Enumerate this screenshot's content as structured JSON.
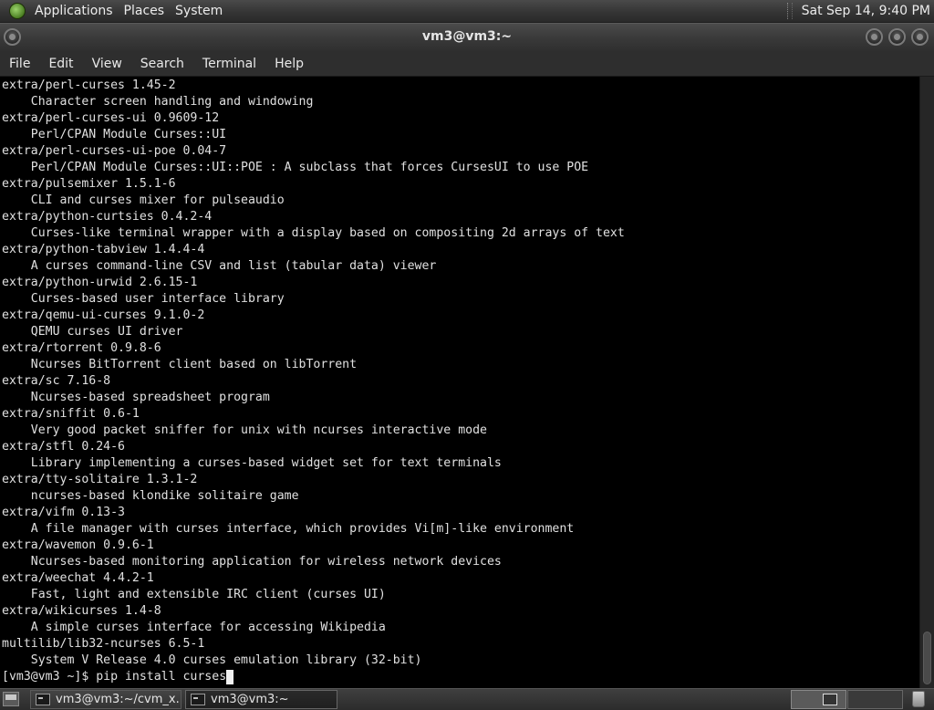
{
  "top_panel": {
    "menus": [
      "Applications",
      "Places",
      "System"
    ],
    "clock": "Sat Sep 14,  9:40 PM"
  },
  "window": {
    "title": "vm3@vm3:~"
  },
  "menubar": {
    "items": [
      "File",
      "Edit",
      "View",
      "Search",
      "Terminal",
      "Help"
    ]
  },
  "terminal": {
    "lines": [
      "extra/perl-curses 1.45-2",
      "    Character screen handling and windowing",
      "extra/perl-curses-ui 0.9609-12",
      "    Perl/CPAN Module Curses::UI",
      "extra/perl-curses-ui-poe 0.04-7",
      "    Perl/CPAN Module Curses::UI::POE : A subclass that forces CursesUI to use POE",
      "extra/pulsemixer 1.5.1-6",
      "    CLI and curses mixer for pulseaudio",
      "extra/python-curtsies 0.4.2-4",
      "    Curses-like terminal wrapper with a display based on compositing 2d arrays of text",
      "extra/python-tabview 1.4.4-4",
      "    A curses command-line CSV and list (tabular data) viewer",
      "extra/python-urwid 2.6.15-1",
      "    Curses-based user interface library",
      "extra/qemu-ui-curses 9.1.0-2",
      "    QEMU curses UI driver",
      "extra/rtorrent 0.9.8-6",
      "    Ncurses BitTorrent client based on libTorrent",
      "extra/sc 7.16-8",
      "    Ncurses-based spreadsheet program",
      "extra/sniffit 0.6-1",
      "    Very good packet sniffer for unix with ncurses interactive mode",
      "extra/stfl 0.24-6",
      "    Library implementing a curses-based widget set for text terminals",
      "extra/tty-solitaire 1.3.1-2",
      "    ncurses-based klondike solitaire game",
      "extra/vifm 0.13-3",
      "    A file manager with curses interface, which provides Vi[m]-like environment",
      "extra/wavemon 0.9.6-1",
      "    Ncurses-based monitoring application for wireless network devices",
      "extra/weechat 4.4.2-1",
      "    Fast, light and extensible IRC client (curses UI)",
      "extra/wikicurses 1.4-8",
      "    A simple curses interface for accessing Wikipedia",
      "multilib/lib32-ncurses 6.5-1",
      "    System V Release 4.0 curses emulation library (32-bit)"
    ],
    "prompt": "[vm3@vm3 ~]$ ",
    "command": "pip install curses"
  },
  "taskbar": {
    "tasks": [
      {
        "label": "vm3@vm3:~/cvm_x...",
        "icon": "terminal-icon"
      },
      {
        "label": "vm3@vm3:~",
        "icon": "terminal-icon"
      }
    ]
  },
  "colors": {
    "terminal_bg": "#000000",
    "terminal_fg": "#e0e0e0",
    "panel_bg": "#333333"
  }
}
